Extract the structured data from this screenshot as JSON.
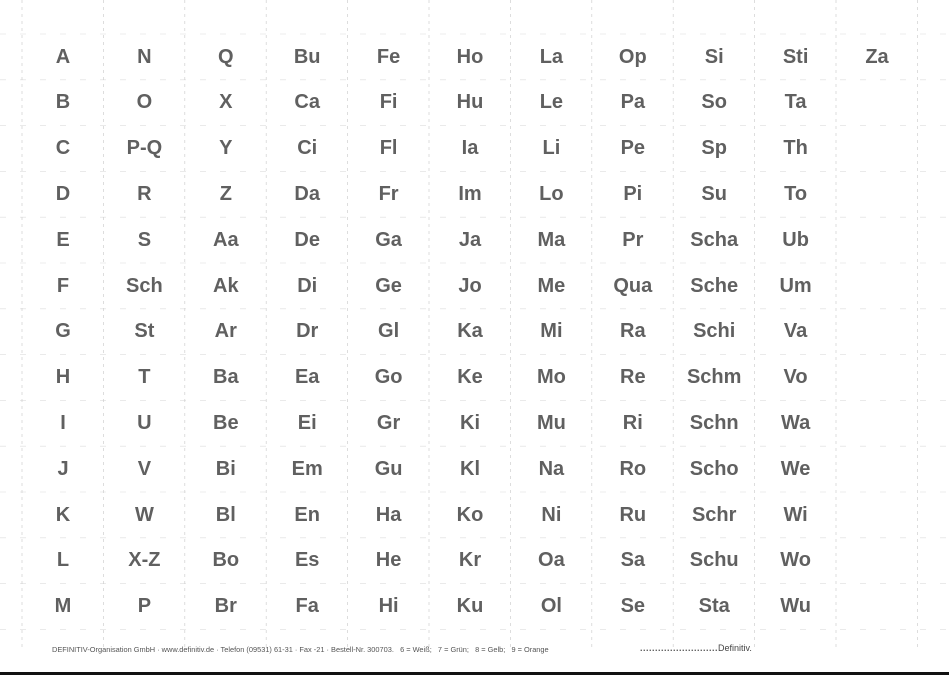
{
  "document": {
    "type": "alphabetical index tabs sheet",
    "columns": [
      [
        "A",
        "B",
        "C",
        "D",
        "E",
        "F",
        "G",
        "H",
        "I",
        "J",
        "K",
        "L",
        "M"
      ],
      [
        "N",
        "O",
        "P-Q",
        "R",
        "S",
        "Sch",
        "St",
        "T",
        "U",
        "V",
        "W",
        "X-Z",
        "P"
      ],
      [
        "Q",
        "X",
        "Y",
        "Z",
        "Aa",
        "Ak",
        "Ar",
        "Ba",
        "Be",
        "Bi",
        "Bl",
        "Bo",
        "Br"
      ],
      [
        "Bu",
        "Ca",
        "Ci",
        "Da",
        "De",
        "Di",
        "Dr",
        "Ea",
        "Ei",
        "Em",
        "En",
        "Es",
        "Fa"
      ],
      [
        "Fe",
        "Fi",
        "Fl",
        "Fr",
        "Ga",
        "Ge",
        "Gl",
        "Go",
        "Gr",
        "Gu",
        "Ha",
        "He",
        "Hi"
      ],
      [
        "Ho",
        "Hu",
        "Ia",
        "Im",
        "Ja",
        "Jo",
        "Ka",
        "Ke",
        "Ki",
        "Kl",
        "Ko",
        "Kr",
        "Ku"
      ],
      [
        "La",
        "Le",
        "Li",
        "Lo",
        "Ma",
        "Me",
        "Mi",
        "Mo",
        "Mu",
        "Na",
        "Ni",
        "Oa",
        "Ol"
      ],
      [
        "Op",
        "Pa",
        "Pe",
        "Pi",
        "Pr",
        "Qua",
        "Ra",
        "Re",
        "Ri",
        "Ro",
        "Ru",
        "Sa",
        "Se"
      ],
      [
        "Si",
        "So",
        "Sp",
        "Su",
        "Scha",
        "Sche",
        "Schi",
        "Schm",
        "Schn",
        "Scho",
        "Schr",
        "Schu",
        "Sta"
      ],
      [
        "Sti",
        "Ta",
        "Th",
        "To",
        "Ub",
        "Um",
        "Va",
        "Vo",
        "Wa",
        "We",
        "Wi",
        "Wo",
        "Wu"
      ],
      [
        "Za"
      ]
    ]
  },
  "footer": {
    "company_line": "DEFINITIV-Organisation GmbH · www.definitiv.de · Telefon (09531) 61-31 · Fax -21 · Bestell-Nr. 300703.",
    "color_codes": "6 = Weiß;   7 = Grün;   8 = Gelb;   9 = Orange",
    "signature_dots": "..........................",
    "signature_brand": "Definitiv."
  },
  "colors": {
    "text": "#606060",
    "grid": "#cfcfcf",
    "rule": "#111111"
  }
}
